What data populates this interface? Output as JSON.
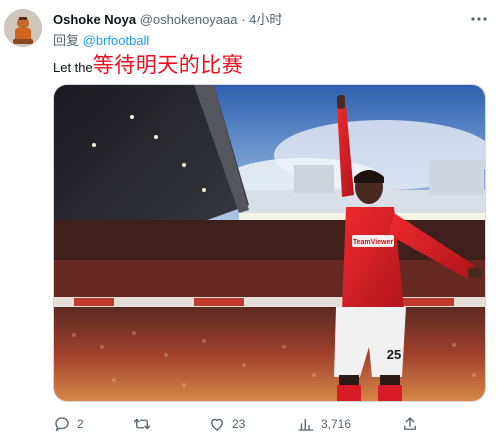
{
  "tweet": {
    "author": {
      "display_name": "Oshoke Noya",
      "handle": "@oshokenoyaaa",
      "separator": "·",
      "time": "4小时"
    },
    "reply_prefix": "回复",
    "reply_to": "@brfootball",
    "text_plain": "Let the",
    "text_highlight": "等待明天的比赛",
    "media": {
      "description_icon": "photo",
      "shirt_sponsor": "TeamViewer",
      "shirt_number": "25"
    },
    "actions": {
      "replies": "2",
      "retweets": "",
      "likes": "23",
      "views": "3,716"
    }
  },
  "colors": {
    "text": "#0f1419",
    "secondary": "#536471",
    "link": "#1d9bf0",
    "highlight": "#e8101e",
    "kit_red": "#d81c25"
  },
  "icons": {
    "more": "more-horizontal-icon",
    "reply": "reply-bubble-icon",
    "retweet": "retweet-icon",
    "like": "heart-icon",
    "views": "bar-chart-icon",
    "share": "share-upload-icon"
  }
}
